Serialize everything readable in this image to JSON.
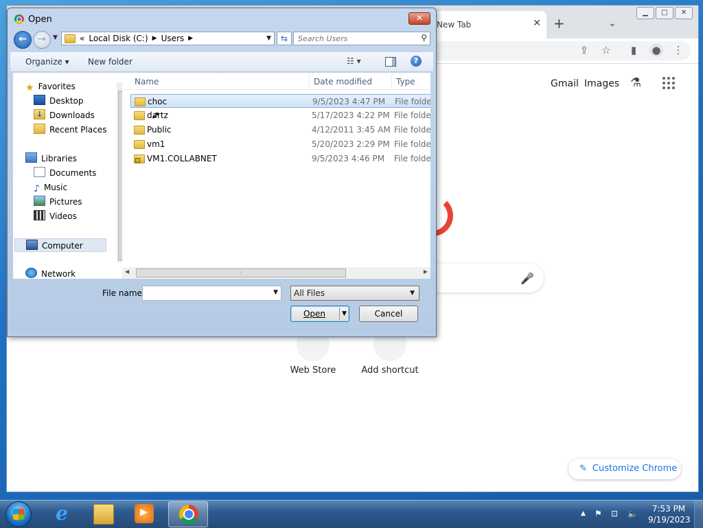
{
  "chrome": {
    "tab_title": "New Tab",
    "tab_close": "✕",
    "new_tab": "+",
    "tab_search": "⌄",
    "header_links": {
      "gmail": "Gmail",
      "images": "Images"
    },
    "shortcuts": [
      {
        "label": "Web Store"
      },
      {
        "label": "Add shortcut"
      }
    ],
    "customize_label": "Customize Chrome"
  },
  "dialog": {
    "title": "Open",
    "close_symbol": "✕",
    "breadcrumb": [
      "Local Disk (C:)",
      "Users"
    ],
    "breadcrumb_prefix": "«",
    "search_placeholder": "Search Users",
    "toolbar": {
      "organize": "Organize ▾",
      "new_folder": "New folder",
      "views": "☷ ▾",
      "help": "?"
    },
    "nav": {
      "favorites": "Favorites",
      "desktop": "Desktop",
      "downloads": "Downloads",
      "recent": "Recent Places",
      "libraries": "Libraries",
      "documents": "Documents",
      "music": "Music",
      "pictures": "Pictures",
      "videos": "Videos",
      "computer": "Computer",
      "network": "Network"
    },
    "columns": {
      "name": "Name",
      "date": "Date modified",
      "type": "Type"
    },
    "files": [
      {
        "name": "choc",
        "date": "9/5/2023 4:47 PM",
        "type": "File folder"
      },
      {
        "name": "dartz",
        "date": "5/17/2023 4:22 PM",
        "type": "File folder"
      },
      {
        "name": "Public",
        "date": "4/12/2011 3:45 AM",
        "type": "File folder"
      },
      {
        "name": "vm1",
        "date": "5/20/2023 2:29 PM",
        "type": "File folder"
      },
      {
        "name": "VM1.COLLABNET",
        "date": "9/5/2023 4:46 PM",
        "type": "File folder"
      }
    ],
    "file_name_label": "File name:",
    "file_name_value": "",
    "filter_value": "All Files",
    "open_button": "Open",
    "cancel_button": "Cancel"
  },
  "taskbar": {
    "clock_time": "7:53 PM",
    "clock_date": "9/19/2023"
  }
}
